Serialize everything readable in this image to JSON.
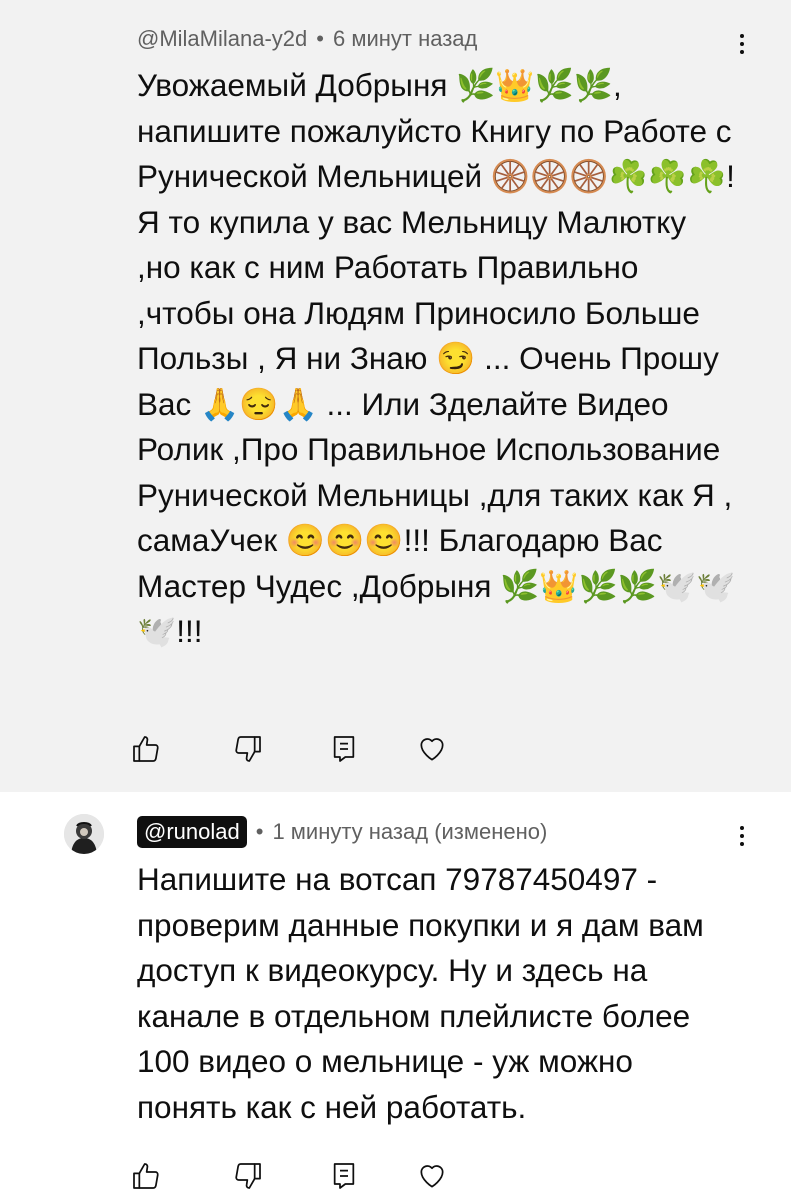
{
  "comments": [
    {
      "author": "@MilaMilana-y2d",
      "time": "6 минут назад",
      "text": "Увожаемый Добрыня 🌿👑🌿🌿, напишите пожалуйсто Книгу по Работе с Рунической Мельницей 🛞🛞🛞☘️☘️☘️! Я то купила у вас Мельницу Малютку ,но как с ним Работать Правильно ,чтобы она Людям Приносило Больше Пользы , Я ни Знаю 😏 ... Очень Прошу Вас 🙏😔🙏 ... Или Зделайте Видео Ролик ,Про Правильное Использование Рунической Мельницы ,для таких как Я , самаУчек 😊😊😊!!! Благодарю Вас Мастер Чудес ,Добрыня 🌿👑🌿🌿🕊️🕊️🕊️!!!",
      "menu_icon": "more-vertical-icon",
      "actions": [
        "thumb-up-icon",
        "thumb-down-icon",
        "reply-icon",
        "heart-icon"
      ]
    },
    {
      "author": "@runolad",
      "time": "1 минуту назад (изменено)",
      "text": "Напишите на вотсап 79787450497 - проверим данные покупки и я дам вам доступ к видеокурсу. Ну и здесь на канале в отдельном плейлисте более 100 видео о мельнице - уж можно понять как с ней работать.",
      "menu_icon": "more-vertical-icon",
      "actions": [
        "thumb-up-icon",
        "thumb-down-icon",
        "reply-icon",
        "heart-icon"
      ]
    }
  ],
  "colors": {
    "first_comment_bg": "#f2f2f2",
    "second_comment_bg": "#ffffff",
    "meta_text": "#606060",
    "channel_chip_bg": "#0f0f0f"
  }
}
